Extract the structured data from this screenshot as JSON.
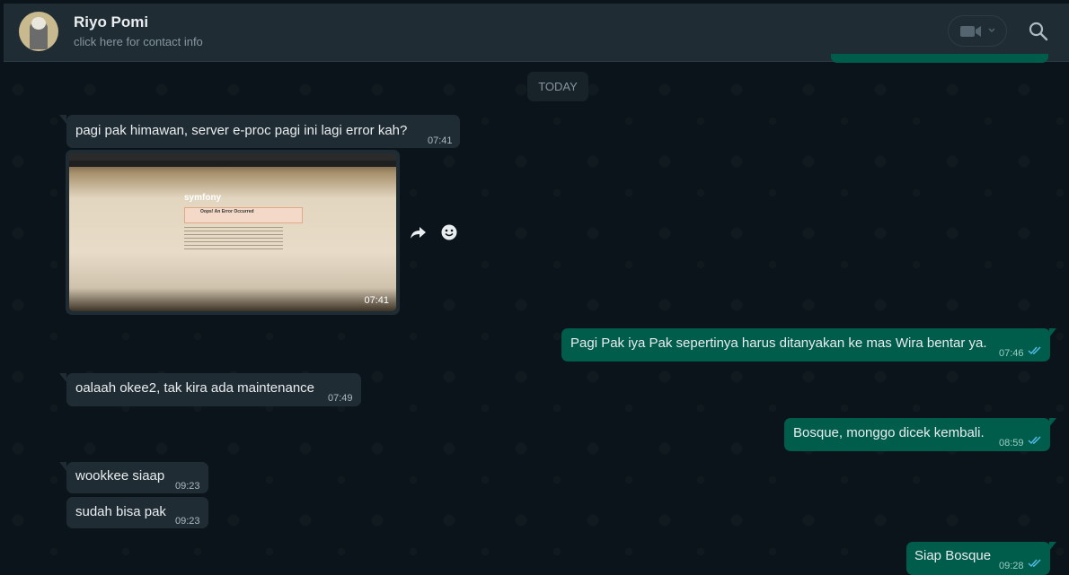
{
  "header": {
    "contact_name": "Riyo Pomi",
    "contact_sub": "click here for contact info",
    "video_icon": "video-camera-icon",
    "search_icon": "search-icon"
  },
  "day_separator": "TODAY",
  "messages": [
    {
      "dir": "in",
      "text": "pagi pak himawan, server e-proc pagi ini lagi error kah?",
      "time": "07:41"
    },
    {
      "dir": "in",
      "type": "image",
      "time": "07:41",
      "image_text": {
        "logo": "symfony",
        "error_title": "Oops! An Error Occurred"
      }
    },
    {
      "dir": "out",
      "text": "Pagi Pak iya Pak sepertinya harus ditanyakan ke mas Wira bentar ya.",
      "time": "07:46",
      "status": "read"
    },
    {
      "dir": "in",
      "text": "oalaah okee2, tak kira ada maintenance",
      "time": "07:49"
    },
    {
      "dir": "out",
      "text": "Bosque, monggo dicek kembali.",
      "time": "08:59",
      "status": "read"
    },
    {
      "dir": "in",
      "text": "wookkee siaap",
      "time": "09:23"
    },
    {
      "dir": "in",
      "text": "sudah bisa pak",
      "time": "09:23"
    },
    {
      "dir": "out",
      "text": "Siap Bosque",
      "time": "09:28",
      "status": "read"
    }
  ],
  "image_actions": {
    "forward_icon": "forward-icon",
    "react_icon": "emoji-icon"
  },
  "colors": {
    "incoming": "#202c33",
    "outgoing": "#005c4b",
    "background": "#0b141a",
    "read_ticks": "#53bdeb"
  }
}
